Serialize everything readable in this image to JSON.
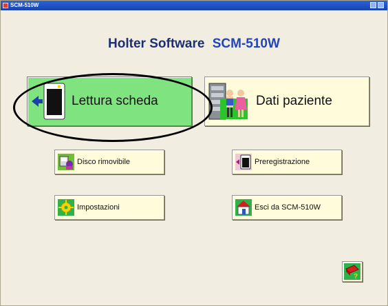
{
  "window": {
    "title": "SCM-510W",
    "app_icon": "app-icon",
    "controls": [
      "restore-icon",
      "close-icon"
    ]
  },
  "header": {
    "title": "Holter Software",
    "product": "SCM-510W"
  },
  "buttons": {
    "lettura": {
      "label": "Lettura scheda",
      "icon": "card-reader-icon",
      "highlighted": true,
      "color": "#7fe37f"
    },
    "dati": {
      "label": "Dati paziente",
      "icon": "patient-data-icon"
    },
    "disco": {
      "label": "Disco rimovibile",
      "icon": "removable-disk-icon"
    },
    "prereg": {
      "label": "Preregistrazione",
      "icon": "preregistration-icon"
    },
    "impost": {
      "label": "Impostazioni",
      "icon": "settings-icon"
    },
    "esci": {
      "label": "Esci da SCM-510W",
      "icon": "exit-house-icon"
    },
    "help": {
      "icon": "help-book-icon"
    }
  },
  "annotation": {
    "type": "ellipse-highlight",
    "target": "lettura"
  },
  "colors": {
    "title_text": "#1d2f74",
    "button_bg": "#fffbdb",
    "window_bg": "#f1ede1",
    "titlebar": "#2c63d8"
  }
}
